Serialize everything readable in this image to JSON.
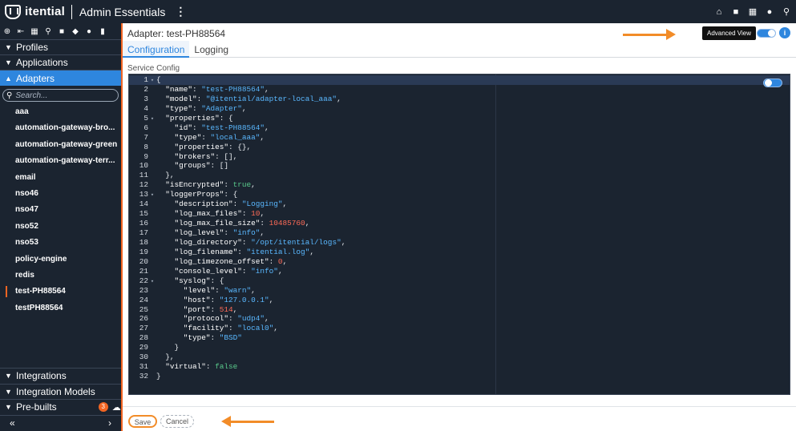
{
  "header": {
    "brand": "itential",
    "app_name": "Admin Essentials",
    "menu_icon": "kebab-icon",
    "icons": [
      "home-icon",
      "briefcase-icon",
      "grid-icon",
      "user-icon",
      "search-icon"
    ]
  },
  "sidebar": {
    "toolbar_icons": [
      "add-icon",
      "import-icon",
      "grid-icon",
      "search-icon",
      "briefcase-icon",
      "tag-icon",
      "account-icon",
      "document-icon"
    ],
    "sections_top": [
      {
        "label": "Profiles",
        "expanded": false
      },
      {
        "label": "Applications",
        "expanded": false
      },
      {
        "label": "Adapters",
        "expanded": true
      }
    ],
    "search": {
      "placeholder": "Search..."
    },
    "adapters": [
      {
        "label": "aaa",
        "selected": false
      },
      {
        "label": "automation-gateway-bro...",
        "selected": false
      },
      {
        "label": "automation-gateway-green",
        "selected": false
      },
      {
        "label": "automation-gateway-terr...",
        "selected": false
      },
      {
        "label": "email",
        "selected": false
      },
      {
        "label": "nso46",
        "selected": false
      },
      {
        "label": "nso47",
        "selected": false
      },
      {
        "label": "nso52",
        "selected": false
      },
      {
        "label": "nso53",
        "selected": false
      },
      {
        "label": "policy-engine",
        "selected": false
      },
      {
        "label": "redis",
        "selected": false
      },
      {
        "label": "test-PH88564",
        "selected": true
      },
      {
        "label": "testPH88564",
        "selected": false
      }
    ],
    "sections_bottom": [
      {
        "label": "Integrations"
      },
      {
        "label": "Integration Models"
      },
      {
        "label": "Pre-builts",
        "badge": "3"
      }
    ],
    "collapse_left": "«",
    "collapse_right": "›"
  },
  "main": {
    "title": "Adapter: test-PH88564",
    "advanced_view_tooltip": "Advanced View",
    "advanced_view_enabled": true,
    "tabs": [
      {
        "label": "Configuration",
        "active": true
      },
      {
        "label": "Logging",
        "active": false
      }
    ],
    "section_label": "Service Config",
    "save_label": "Save",
    "cancel_label": "Cancel"
  },
  "colors": {
    "sidebar_bg": "#1b2430",
    "accent_blue": "#2e86de",
    "accent_orange": "#f26522",
    "annotation_arrow": "#f28c28"
  }
}
